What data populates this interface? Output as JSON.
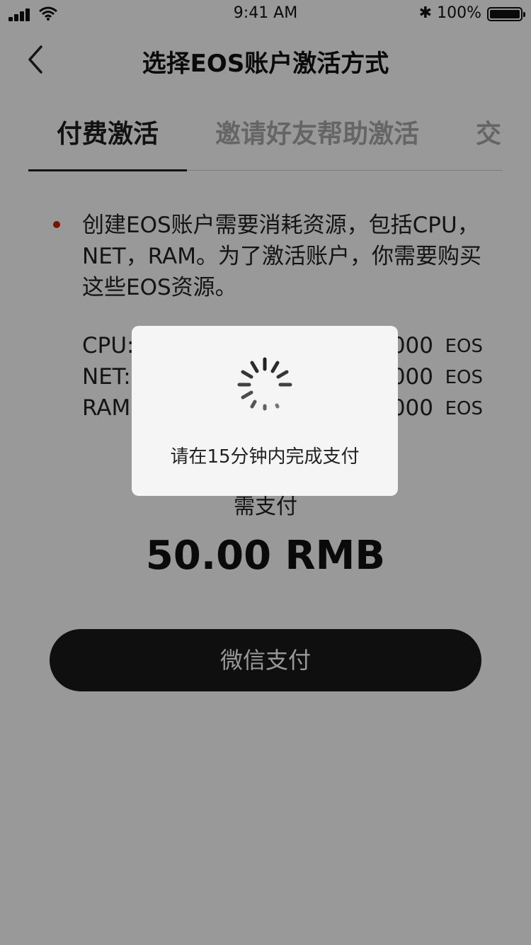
{
  "status_bar": {
    "time": "9:41 AM",
    "battery": "100%",
    "bluetooth": "✱"
  },
  "nav": {
    "title": "选择EOS账户激活方式"
  },
  "tabs": [
    {
      "label": "付费激活"
    },
    {
      "label": "邀请好友帮助激活"
    },
    {
      "label": "交"
    }
  ],
  "content": {
    "description": "创建EOS账户需要消耗资源，包括CPU，NET，RAM。为了激活账户，你需要购买这些EOS资源。",
    "resources": [
      {
        "label": "CPU:",
        "value": "000",
        "unit": "EOS"
      },
      {
        "label": "NET:",
        "value": "000",
        "unit": "EOS"
      },
      {
        "label": "RAM",
        "value": "000",
        "unit": "EOS"
      }
    ],
    "need_pay_label": "需支付",
    "amount": "50.00 RMB",
    "pay_button": "微信支付"
  },
  "toast": {
    "message": "请在15分钟内完成支付"
  },
  "colors": {
    "bullet": "#cc2200",
    "button": "#1a1a1a",
    "overlay": "rgba(0,0,0,0.40)"
  }
}
